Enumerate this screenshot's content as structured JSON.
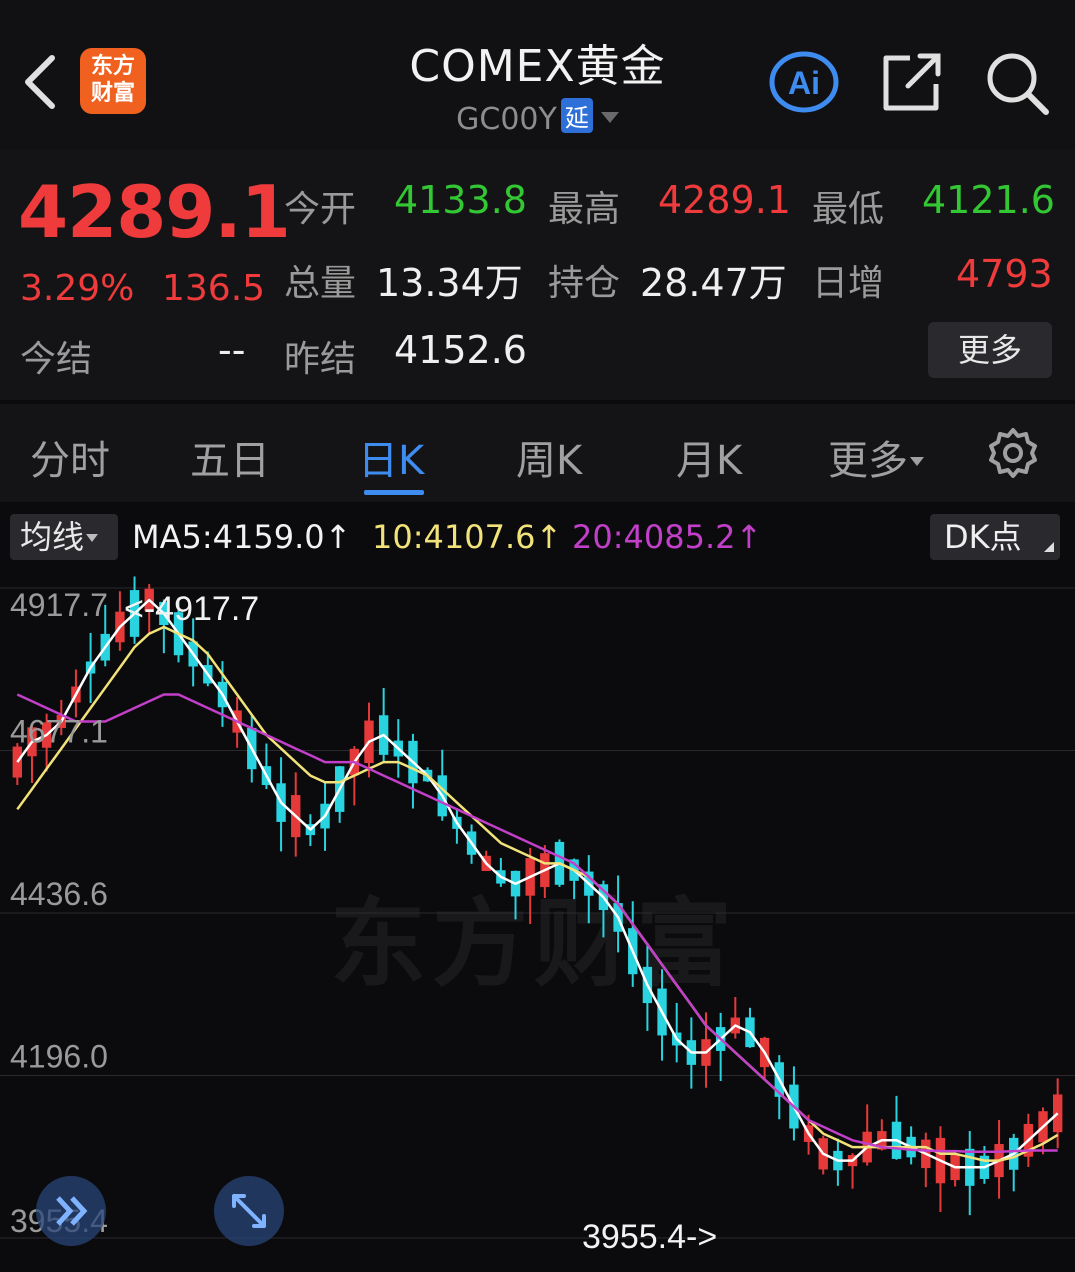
{
  "header": {
    "title": "COMEX黄金",
    "code": "GC00Y",
    "delay_tag": "延",
    "logo_line1": "东方",
    "logo_line2": "财富",
    "ai_label": "Ai"
  },
  "quote": {
    "price": "4289.1",
    "change_pct": "3.29%",
    "change": "136.5",
    "fields": {
      "open_label": "今开",
      "open": "4133.8",
      "high_label": "最高",
      "high": "4289.1",
      "low_label": "最低",
      "low": "4121.6",
      "volume_label": "总量",
      "volume": "13.34万",
      "oi_label": "持仓",
      "oi": "28.47万",
      "daily_inc_label": "日增",
      "daily_inc": "4793",
      "settle_label": "今结",
      "settle": "--",
      "prev_settle_label": "昨结",
      "prev_settle": "4152.6"
    },
    "more_label": "更多"
  },
  "tabs": [
    {
      "label": "分时"
    },
    {
      "label": "五日"
    },
    {
      "label": "日K"
    },
    {
      "label": "周K"
    },
    {
      "label": "月K"
    },
    {
      "label": "更多"
    }
  ],
  "ma_row": {
    "selector": "均线",
    "ma5": "MA5:4159.0↑",
    "ma10": "10:4107.6↑",
    "ma20": "20:4085.2↑",
    "dk_label": "DK点"
  },
  "colors": {
    "up": "#ef3b3b",
    "down": "#33c733",
    "bull_candle": "#e5393a",
    "bear_candle": "#29d3e0",
    "ma5": "#ffffff",
    "ma10": "#f2e27a",
    "ma20": "#c23fc9",
    "accent": "#3f8cf0"
  },
  "chart_data": {
    "type": "candlestick",
    "y_ticks": [
      "4917.7",
      "4677.1",
      "4436.6",
      "4196.0",
      "3955.4"
    ],
    "ylim": [
      3955.4,
      4917.7
    ],
    "max_annotation": "<-4917.7",
    "min_annotation": "3955.4->",
    "watermark": "东方财富",
    "series": [
      {
        "name": "MA5",
        "color": "#ffffff",
        "values": [
          4660,
          4690,
          4700,
          4720,
          4760,
          4800,
          4830,
          4860,
          4880,
          4900,
          4880,
          4850,
          4820,
          4790,
          4760,
          4720,
          4680,
          4640,
          4600,
          4580,
          4560,
          4580,
          4620,
          4660,
          4690,
          4700,
          4680,
          4660,
          4640,
          4610,
          4570,
          4540,
          4510,
          4490,
          4480,
          4490,
          4500,
          4510,
          4500,
          4480,
          4460,
          4430,
          4380,
          4330,
          4290,
          4250,
          4230,
          4230,
          4250,
          4270,
          4260,
          4230,
          4190,
          4150,
          4110,
          4080,
          4070,
          4070,
          4090,
          4100,
          4100,
          4090,
          4080,
          4070,
          4060,
          4060,
          4060,
          4070,
          4080,
          4100,
          4120,
          4140
        ]
      },
      {
        "name": "MA10",
        "color": "#f2e27a",
        "values": [
          4590,
          4620,
          4650,
          4680,
          4710,
          4740,
          4770,
          4800,
          4830,
          4850,
          4860,
          4850,
          4840,
          4820,
          4790,
          4760,
          4730,
          4700,
          4680,
          4660,
          4640,
          4630,
          4630,
          4640,
          4650,
          4660,
          4660,
          4650,
          4640,
          4620,
          4600,
          4580,
          4560,
          4540,
          4530,
          4520,
          4510,
          4510,
          4500,
          4490,
          4470,
          4450,
          4420,
          4390,
          4360,
          4330,
          4300,
          4270,
          4250,
          4230,
          4210,
          4190,
          4170,
          4150,
          4130,
          4110,
          4100,
          4090,
          4090,
          4090,
          4090,
          4090,
          4090,
          4080,
          4080,
          4075,
          4070,
          4070,
          4075,
          4085,
          4095,
          4108
        ]
      },
      {
        "name": "MA20",
        "color": "#c23fc9",
        "values": [
          4760,
          4750,
          4740,
          4730,
          4720,
          4720,
          4720,
          4730,
          4740,
          4750,
          4760,
          4760,
          4750,
          4740,
          4730,
          4720,
          4710,
          4700,
          4690,
          4680,
          4670,
          4660,
          4660,
          4660,
          4650,
          4640,
          4630,
          4620,
          4610,
          4600,
          4590,
          4580,
          4570,
          4560,
          4550,
          4540,
          4530,
          4520,
          4510,
          4490,
          4470,
          4450,
          4420,
          4390,
          4360,
          4330,
          4300,
          4270,
          4250,
          4230,
          4210,
          4190,
          4170,
          4150,
          4130,
          4120,
          4110,
          4100,
          4095,
          4090,
          4088,
          4086,
          4085,
          4084,
          4084,
          4083,
          4083,
          4083,
          4084,
          4085,
          4085,
          4085
        ]
      }
    ]
  }
}
